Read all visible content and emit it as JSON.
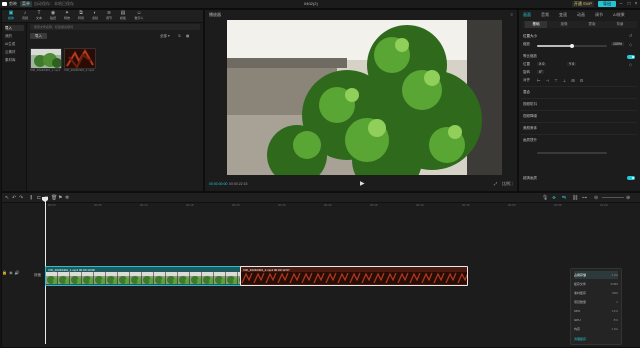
{
  "menubar": {
    "app_name": "剪映",
    "menu": "菜单",
    "autosave": "自动保存：本地已保存",
    "project_title": "0402(2)",
    "pro_label": "开通 SVIP",
    "export_label": "导出"
  },
  "toolbar": {
    "tools": [
      {
        "label": "媒体",
        "icon": "▣",
        "active": true
      },
      {
        "label": "音频",
        "icon": "♪"
      },
      {
        "label": "文本",
        "icon": "T"
      },
      {
        "label": "贴纸",
        "icon": "◉"
      },
      {
        "label": "特效",
        "icon": "✦"
      },
      {
        "label": "转场",
        "icon": "⧉"
      },
      {
        "label": "滤镜",
        "icon": "◐"
      },
      {
        "label": "调节",
        "icon": "≋"
      },
      {
        "label": "模板",
        "icon": "▤"
      },
      {
        "label": "数字人",
        "icon": "☺"
      }
    ]
  },
  "media": {
    "sidebar": [
      "导入",
      "我的",
      "AI生成",
      "云素材",
      "素材库"
    ],
    "search_placeholder": "搜索文件名称、标签或关键词",
    "import_label": "导入",
    "view_label": "全部",
    "items": [
      {
        "caption": "VID_20240402_1.mp4",
        "thumb": "green"
      },
      {
        "caption": "VID_20240402_2.mp4",
        "thumb": "red"
      }
    ]
  },
  "player": {
    "header": "播放器",
    "current_time": "00:00:00:00",
    "total_time": "00:00:22:15",
    "ratio_label": "比例",
    "fullscreen_label": "全屏"
  },
  "props": {
    "tabs": [
      "画面",
      "音频",
      "变速",
      "动画",
      "调节",
      "AI效果"
    ],
    "subtabs": [
      "基础",
      "抠像",
      "蒙版",
      "背景"
    ],
    "section_position": "位置大小",
    "scale_label": "缩放",
    "scale_value": "100%",
    "uniform_label": "等比缩放",
    "position_label": "位置",
    "pos_x": "0",
    "pos_y": "0",
    "rotate_label": "旋转",
    "rotate_value": "0°",
    "align_label": "对齐",
    "blend_label": "混合",
    "stabilize_label": "视频防抖",
    "denoise_label": "视频降噪",
    "beautify_label": "美颜美体",
    "quality_label": "画质提升",
    "extra_label": "超清画质",
    "scale_percent": 100
  },
  "timeline": {
    "ruler_ticks": [
      "00:00",
      "00:05",
      "00:10",
      "00:15",
      "00:20",
      "00:25",
      "00:30",
      "00:35",
      "00:40",
      "00:45",
      "00:50",
      "00:55",
      "01:00"
    ],
    "cover_label": "封面",
    "clips": [
      {
        "caption": "VID_20240402_1.mp4  00:00:10:08",
        "tone": "green"
      },
      {
        "caption": "VID_20240402_2.mp4  00:00:12:07",
        "tone": "red"
      }
    ],
    "popup": {
      "rows": [
        {
          "label": "占用存储",
          "value": "1.2G"
        },
        {
          "label": "缓存文件",
          "value": "328M"
        },
        {
          "label": "素材缓存",
          "value": "86M"
        },
        {
          "label": "项目数量",
          "value": "2"
        },
        {
          "label": "CPU",
          "value": "12%"
        },
        {
          "label": "GPU",
          "value": "8%"
        },
        {
          "label": "内存",
          "value": "1.6G"
        }
      ],
      "footer": "清理缓存"
    }
  },
  "colors": {
    "accent": "#28c8d8",
    "background": "#141414",
    "panel": "#1c1c1c"
  }
}
